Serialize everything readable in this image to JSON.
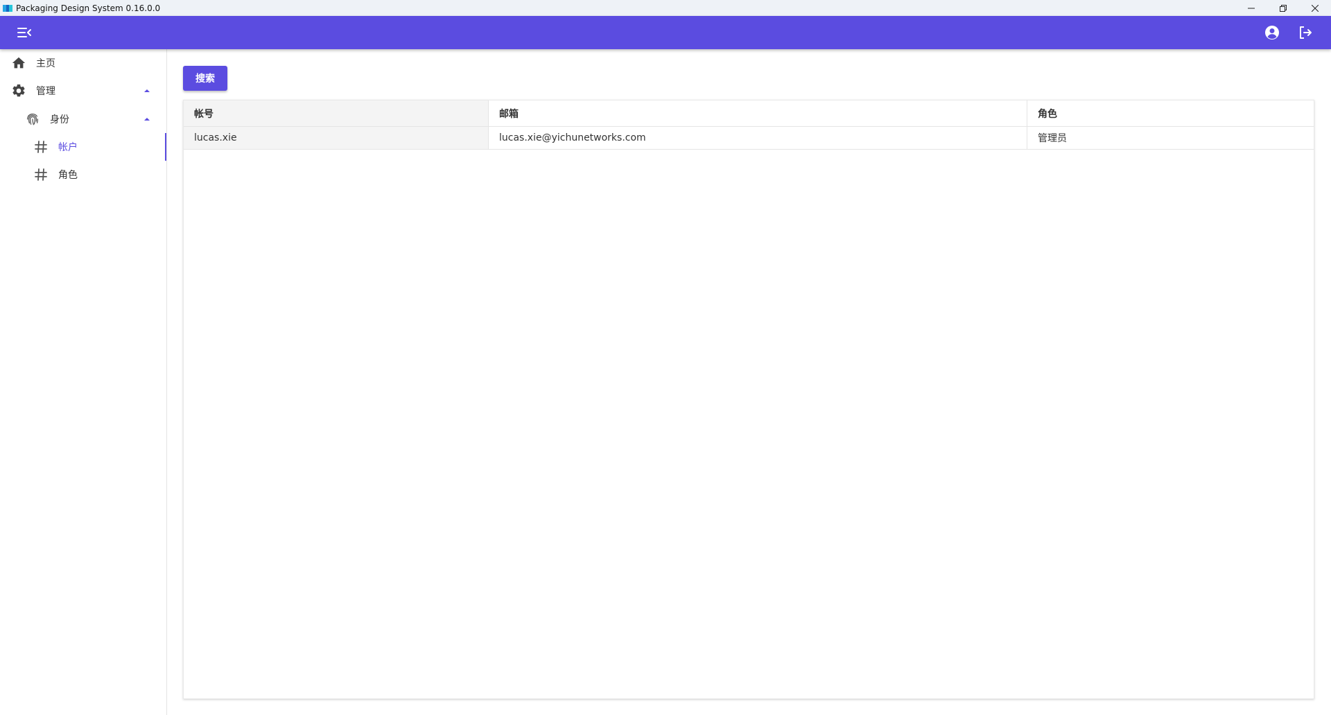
{
  "window": {
    "title": "Packaging Design System 0.16.0.0",
    "controls": [
      "minimize-icon",
      "restore-icon",
      "close-icon"
    ]
  },
  "header": {
    "background": "#5b4ce0",
    "icons": [
      "menu-fold-icon",
      "account-circle-icon",
      "logout-icon"
    ]
  },
  "sidebar": {
    "items": [
      {
        "label": "主页",
        "icon": "home-icon",
        "level": 0
      },
      {
        "label": "管理",
        "icon": "gear-icon",
        "level": 0,
        "expanded": true
      },
      {
        "label": "身份",
        "icon": "fingerprint-icon",
        "level": 1,
        "expanded": true
      },
      {
        "label": "帐户",
        "icon": "hash-icon",
        "level": 2,
        "active": true
      },
      {
        "label": "角色",
        "icon": "hash-icon",
        "level": 2
      }
    ]
  },
  "main": {
    "search_label": "搜索",
    "table": {
      "columns": [
        "帐号",
        "邮箱",
        "角色"
      ],
      "rows": [
        [
          "lucas.xie",
          "lucas.xie@yichunetworks.com",
          "管理员"
        ]
      ]
    }
  },
  "colors": {
    "accent": "#5b4ce0",
    "titlebar": "#eef2f7",
    "header_cell_bg": "#f4f4f4"
  }
}
